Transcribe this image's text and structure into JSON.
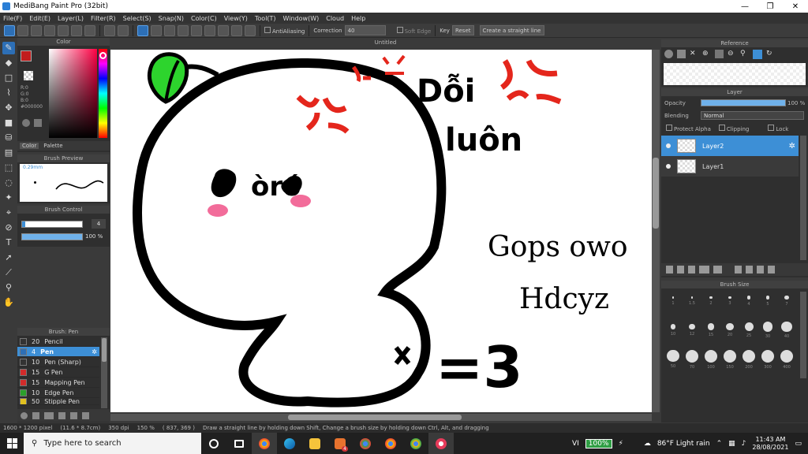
{
  "window": {
    "title": "MediBang Paint Pro (32bit)",
    "controls": [
      "—",
      "❐",
      "✕"
    ]
  },
  "menu": [
    "File(F)",
    "Edit(E)",
    "Layer(L)",
    "Filter(R)",
    "Select(S)",
    "Snap(N)",
    "Color(C)",
    "View(Y)",
    "Tool(T)",
    "Window(W)",
    "Cloud",
    "Help"
  ],
  "toolbar": {
    "antialiasing_label": "AntiAliasing",
    "correction_label": "Correction",
    "correction_value": "40",
    "soft_edge_label": "Soft Edge",
    "key_label": "Key",
    "reset_label": "Reset",
    "straight_line_label": "Create a straight line"
  },
  "document": {
    "title": "Untitled"
  },
  "color_panel": {
    "title": "Color",
    "r": "R:0",
    "g": "G:0",
    "b": "B:0",
    "hex": "#000000",
    "tab_color": "Color",
    "tab_palette": "Palette",
    "primary_color": "#c21d1d",
    "secondary_color": "#ffffff"
  },
  "brush_preview": {
    "title": "Brush Preview",
    "size": "0.29mm"
  },
  "brush_control": {
    "title": "Brush Control",
    "size_value": "4",
    "opacity_value": "100 %"
  },
  "brush_list": {
    "title": "Brush: Pen",
    "items": [
      {
        "size": "20",
        "name": "Pencil",
        "color": "#333333"
      },
      {
        "size": "4",
        "name": "Pen",
        "color": "#2d6fb6"
      },
      {
        "size": "10",
        "name": "Pen (Sharp)",
        "color": "#333333"
      },
      {
        "size": "15",
        "name": "G Pen",
        "color": "#d22b2b"
      },
      {
        "size": "15",
        "name": "Mapping Pen",
        "color": "#d22b2b"
      },
      {
        "size": "10",
        "name": "Edge Pen",
        "color": "#2ba02b"
      },
      {
        "size": "50",
        "name": "Stipple Pen",
        "color": "#e0c020"
      }
    ]
  },
  "reference_panel": {
    "title": "Reference"
  },
  "layer_panel": {
    "title": "Layer",
    "opacity_label": "Opacity",
    "opacity_value": "100 %",
    "opacity_fraction": 1.0,
    "blending_label": "Blending",
    "blending_value": "Normal",
    "protect_alpha": "Protect Alpha",
    "clipping": "Clipping",
    "lock": "Lock",
    "layers": [
      {
        "name": "Layer2"
      },
      {
        "name": "Layer1"
      }
    ]
  },
  "brush_size_panel": {
    "title": "Brush Size",
    "sizes": [
      "1",
      "1.5",
      "2",
      "3",
      "4",
      "5",
      "7",
      "10",
      "12",
      "15",
      "20",
      "25",
      "30",
      "40",
      "50",
      "70",
      "100",
      "150",
      "200",
      "300",
      "400",
      "500",
      "700",
      "1000"
    ]
  },
  "canvas_text": {
    "angry_text_line1": "Dỗi",
    "angry_text_line2": "luôn",
    "handwriting_line1": "Gops owo",
    "handwriting_line2": "Hdcyz",
    "face_text": "òró",
    "equals3": "=3"
  },
  "status_bar": {
    "canvas_size": "1600 * 1200 pixel",
    "physical_size": "(11.6 * 8.7cm)",
    "dpi": "350 dpi",
    "zoom": "150 %",
    "cursor": "( 837, 369 )",
    "hint": "Draw a straight line by holding down Shift, Change a brush size by holding down Ctrl, Alt, and dragging"
  },
  "taskbar": {
    "search_placeholder": "Type here to search",
    "lang": "VI",
    "battery": "100%",
    "weather": "86°F  Light rain",
    "time": "11:43 AM",
    "date": "28/08/2021",
    "notif_count": "4"
  }
}
